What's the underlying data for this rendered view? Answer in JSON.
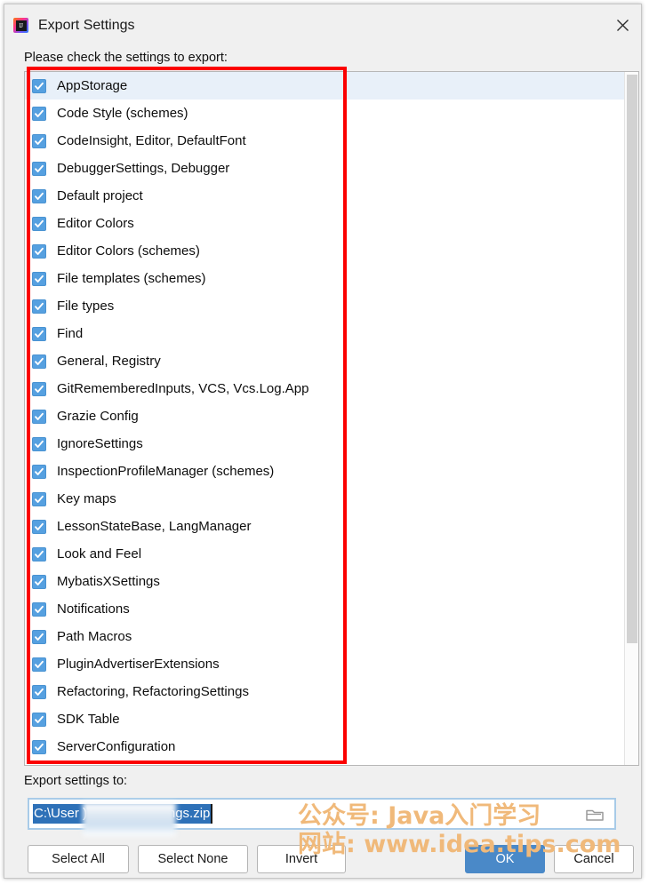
{
  "window": {
    "title": "Export Settings",
    "app_icon": "intellij-idea-icon",
    "icon_text": "IJ",
    "close_icon": "close-icon"
  },
  "prompt": {
    "label": "Please check the settings to export:"
  },
  "settings_list": {
    "items": [
      {
        "label": "AppStorage",
        "checked": true,
        "selected": true
      },
      {
        "label": "Code Style (schemes)",
        "checked": true,
        "selected": false
      },
      {
        "label": "CodeInsight, Editor, DefaultFont",
        "checked": true,
        "selected": false
      },
      {
        "label": "DebuggerSettings, Debugger",
        "checked": true,
        "selected": false
      },
      {
        "label": "Default project",
        "checked": true,
        "selected": false
      },
      {
        "label": "Editor Colors",
        "checked": true,
        "selected": false
      },
      {
        "label": "Editor Colors (schemes)",
        "checked": true,
        "selected": false
      },
      {
        "label": "File templates (schemes)",
        "checked": true,
        "selected": false
      },
      {
        "label": "File types",
        "checked": true,
        "selected": false
      },
      {
        "label": "Find",
        "checked": true,
        "selected": false
      },
      {
        "label": "General, Registry",
        "checked": true,
        "selected": false
      },
      {
        "label": "GitRememberedInputs, VCS, Vcs.Log.App",
        "checked": true,
        "selected": false
      },
      {
        "label": "Grazie Config",
        "checked": true,
        "selected": false
      },
      {
        "label": "IgnoreSettings",
        "checked": true,
        "selected": false
      },
      {
        "label": "InspectionProfileManager (schemes)",
        "checked": true,
        "selected": false
      },
      {
        "label": "Key maps",
        "checked": true,
        "selected": false
      },
      {
        "label": "LessonStateBase, LangManager",
        "checked": true,
        "selected": false
      },
      {
        "label": "Look and Feel",
        "checked": true,
        "selected": false
      },
      {
        "label": "MybatisXSettings",
        "checked": true,
        "selected": false
      },
      {
        "label": "Notifications",
        "checked": true,
        "selected": false
      },
      {
        "label": "Path Macros",
        "checked": true,
        "selected": false
      },
      {
        "label": "PluginAdvertiserExtensions",
        "checked": true,
        "selected": false
      },
      {
        "label": "Refactoring, RefactoringSettings",
        "checked": true,
        "selected": false
      },
      {
        "label": "SDK Table",
        "checked": true,
        "selected": false
      },
      {
        "label": "ServerConfiguration",
        "checked": true,
        "selected": false
      }
    ]
  },
  "scrollbar": {
    "orientation": "vertical",
    "thumb_name": "scrollbar-thumb"
  },
  "annotation": {
    "shape": "rectangle",
    "color": "#fb0000"
  },
  "export_path": {
    "label": "Export settings to:",
    "value": "C:\\User                 )\\Desktop\\settings.zip",
    "value_prefix": "C:\\User",
    "value_suffix": ")\\Desktop\\settings.zip",
    "selected": true,
    "browse_icon": "folder-icon"
  },
  "buttons": {
    "select_all": "Select All",
    "select_none": "Select None",
    "invert": "Invert",
    "ok": "OK",
    "cancel": "Cancel"
  },
  "watermark": {
    "line1": "公众号: Java入门学习",
    "line2": "网站: www.idea.tips.com",
    "color": "#f0b97a"
  },
  "colors": {
    "accent": "#4a89c8",
    "checkbox": "#56a0e0",
    "selection": "#2e71b8",
    "row_selected": "#e8f0f9",
    "annotation": "#fb0000"
  }
}
